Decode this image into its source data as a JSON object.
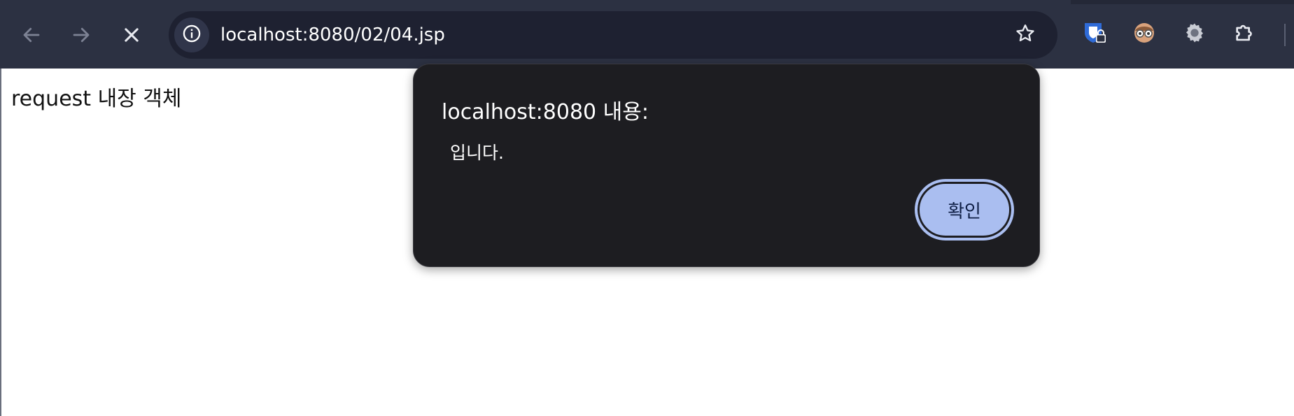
{
  "browser": {
    "url": "localhost:8080/02/04.jsp",
    "icons": {
      "back": "arrow-left-icon",
      "forward": "arrow-right-icon",
      "stop": "close-icon",
      "site_info": "info-icon",
      "bookmark": "star-icon",
      "ext1": "shield-lock-icon",
      "ext2": "avatar-icon",
      "ext3": "gear-icon",
      "ext4": "puzzle-icon"
    },
    "colors": {
      "toolbar": "#2c3142",
      "omnibox": "#1e2131",
      "accent": "#aabef0"
    }
  },
  "page": {
    "text": "request 내장 객체"
  },
  "dialog": {
    "title": "localhost:8080 내용:",
    "message": "입니다.",
    "ok_label": "확인",
    "colors": {
      "background": "#1d1d21",
      "button": "#aabef0"
    }
  }
}
